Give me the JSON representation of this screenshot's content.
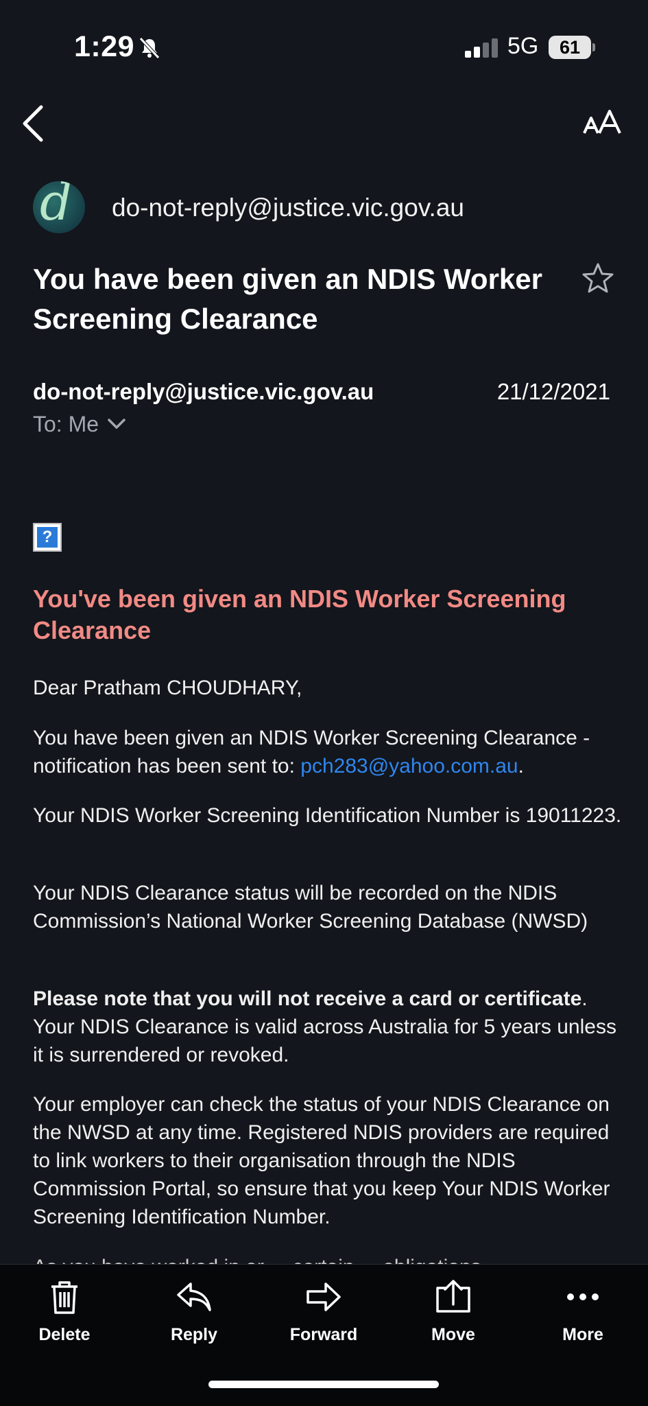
{
  "status_bar": {
    "time": "1:29",
    "network": "5G",
    "battery": "61"
  },
  "sender": {
    "header_address": "do-not-reply@justice.vic.gov.au"
  },
  "subject": "You have been given an NDIS Worker Screening Clearance",
  "meta": {
    "from": "do-not-reply@justice.vic.gov.au",
    "date": "21/12/2021",
    "to": "To: Me"
  },
  "body": {
    "broken_image_glyph": "?",
    "heading": "You've been given an NDIS Worker Screening Clearance",
    "greeting": "Dear Pratham CHOUDHARY,",
    "p1_text": "You have been given an NDIS Worker Screening Clearance - notification has been sent to: ",
    "p1_email": "pch283@yahoo.com.au",
    "p1_end": ".",
    "p2": "Your NDIS Worker Screening Identification Number is 19011223.",
    "p3": "Your NDIS Clearance status will be recorded on the NDIS Commission’s National Worker Screening Database (NWSD)",
    "p4_bold": "Please note that you will not receive a card or certificate",
    "p4_rest": ". Your NDIS Clearance is valid across Australia for 5 years unless it is surrendered or revoked.",
    "p5": "Your employer can check the status of your NDIS Clearance on the NWSD at any time. Registered NDIS providers are required to link workers to their organisation through the NDIS Commission Portal, so ensure that you keep Your NDIS Worker Screening Identification Number.",
    "cut_off": "As you have worked in or ... certain ... obligations"
  },
  "toolbar": {
    "delete": "Delete",
    "reply": "Reply",
    "forward": "Forward",
    "move": "Move",
    "more": "More"
  },
  "icons": [
    "bell-slash-icon",
    "signal-icon",
    "back-chevron-icon",
    "text-size-icon",
    "star-icon",
    "chevron-down-icon",
    "trash-icon",
    "reply-icon",
    "forward-icon",
    "move-icon",
    "more-icon"
  ]
}
